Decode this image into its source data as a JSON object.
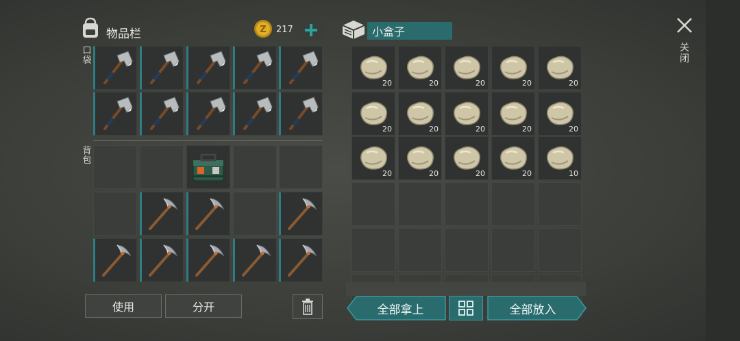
{
  "inventory": {
    "title": "物品栏",
    "coin_count": "217",
    "pocket_label": "口袋",
    "backpack_label": "背包",
    "pocket_slots": [
      "axe",
      "axe",
      "axe",
      "axe",
      "axe",
      "axe",
      "axe",
      "axe",
      "axe",
      "axe"
    ],
    "backpack_slots": [
      "empty",
      "empty",
      "toolbox",
      "empty",
      "empty",
      "empty",
      "pickaxe",
      "pickaxe",
      "empty",
      "pickaxe",
      "pickaxe",
      "pickaxe",
      "pickaxe",
      "pickaxe",
      "pickaxe"
    ],
    "use_label": "使用",
    "split_label": "分开"
  },
  "container": {
    "name": "小盒子",
    "slots": [
      {
        "item": "stone",
        "qty": "20"
      },
      {
        "item": "stone",
        "qty": "20"
      },
      {
        "item": "stone",
        "qty": "20"
      },
      {
        "item": "stone",
        "qty": "20"
      },
      {
        "item": "stone",
        "qty": "20"
      },
      {
        "item": "stone",
        "qty": "20"
      },
      {
        "item": "stone",
        "qty": "20"
      },
      {
        "item": "stone",
        "qty": "20"
      },
      {
        "item": "stone",
        "qty": "20"
      },
      {
        "item": "stone",
        "qty": "20"
      },
      {
        "item": "stone",
        "qty": "20"
      },
      {
        "item": "stone",
        "qty": "20"
      },
      {
        "item": "stone",
        "qty": "20"
      },
      {
        "item": "stone",
        "qty": "20"
      },
      {
        "item": "stone",
        "qty": "10"
      },
      {
        "item": "empty",
        "qty": ""
      },
      {
        "item": "empty",
        "qty": ""
      },
      {
        "item": "empty",
        "qty": ""
      },
      {
        "item": "empty",
        "qty": ""
      },
      {
        "item": "empty",
        "qty": ""
      },
      {
        "item": "empty",
        "qty": ""
      },
      {
        "item": "empty",
        "qty": ""
      },
      {
        "item": "empty",
        "qty": ""
      },
      {
        "item": "empty",
        "qty": ""
      },
      {
        "item": "empty",
        "qty": ""
      },
      {
        "item": "empty",
        "qty": ""
      },
      {
        "item": "empty",
        "qty": ""
      },
      {
        "item": "empty",
        "qty": ""
      },
      {
        "item": "empty",
        "qty": ""
      },
      {
        "item": "empty",
        "qty": ""
      }
    ],
    "take_all_label": "全部拿上",
    "put_all_label": "全部放入"
  },
  "close_label": "关闭",
  "colors": {
    "accent_teal": "#2e7d84",
    "coin_gold": "#d9a520",
    "plus_teal": "#2aa39a"
  }
}
